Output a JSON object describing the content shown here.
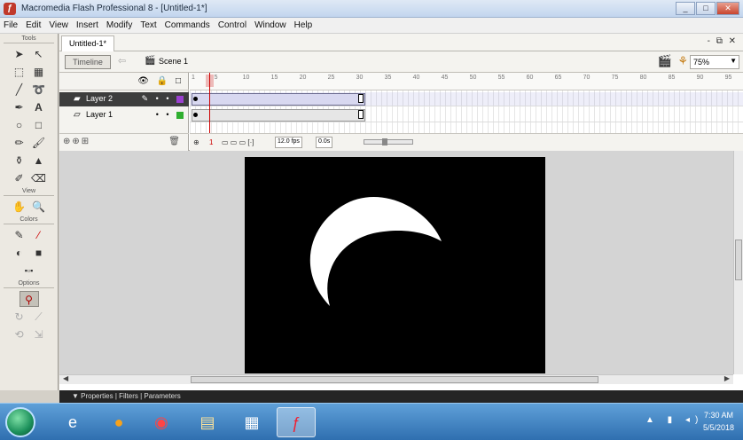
{
  "app": {
    "title": "Macromedia Flash Professional 8 - [Untitled-1*]",
    "window_controls": {
      "minimize": "_",
      "maximize": "□",
      "close": "✕"
    }
  },
  "menu": [
    "File",
    "Edit",
    "View",
    "Insert",
    "Modify",
    "Text",
    "Commands",
    "Control",
    "Window",
    "Help"
  ],
  "tools": {
    "header": "Tools",
    "view_label": "View",
    "colors_label": "Colors",
    "options_label": "Options"
  },
  "document": {
    "tab": "Untitled-1*",
    "doc_controls": "- ⧉ ✕",
    "timeline_button": "Timeline",
    "scene": "Scene 1",
    "zoom": "75%"
  },
  "timeline": {
    "header_icons": "👁 🔒 □",
    "ruler_ticks": [
      "1",
      "5",
      "10",
      "15",
      "20",
      "25",
      "30",
      "35",
      "40",
      "45",
      "50",
      "55",
      "60",
      "65",
      "70",
      "75",
      "80",
      "85",
      "90",
      "95"
    ],
    "layers": [
      {
        "name": "Layer 2",
        "controls": "✎ •  • ",
        "color": "#9b40d0",
        "selected": true
      },
      {
        "name": "Layer 1",
        "controls": "•  • ",
        "color": "#2fae2f",
        "selected": false
      }
    ],
    "status": {
      "frame": "1",
      "fps": "12.0 fps",
      "time": "0.0s"
    }
  },
  "panels": {
    "properties_bar": "▼  Properties | Filters | Parameters"
  },
  "taskbar": {
    "clock_time": "7:30 AM",
    "clock_date": "5/5/2018"
  },
  "colors": {
    "stage_bg": "#000000",
    "moon": "#ffffff",
    "pasteboard": "#d4d4d4"
  }
}
